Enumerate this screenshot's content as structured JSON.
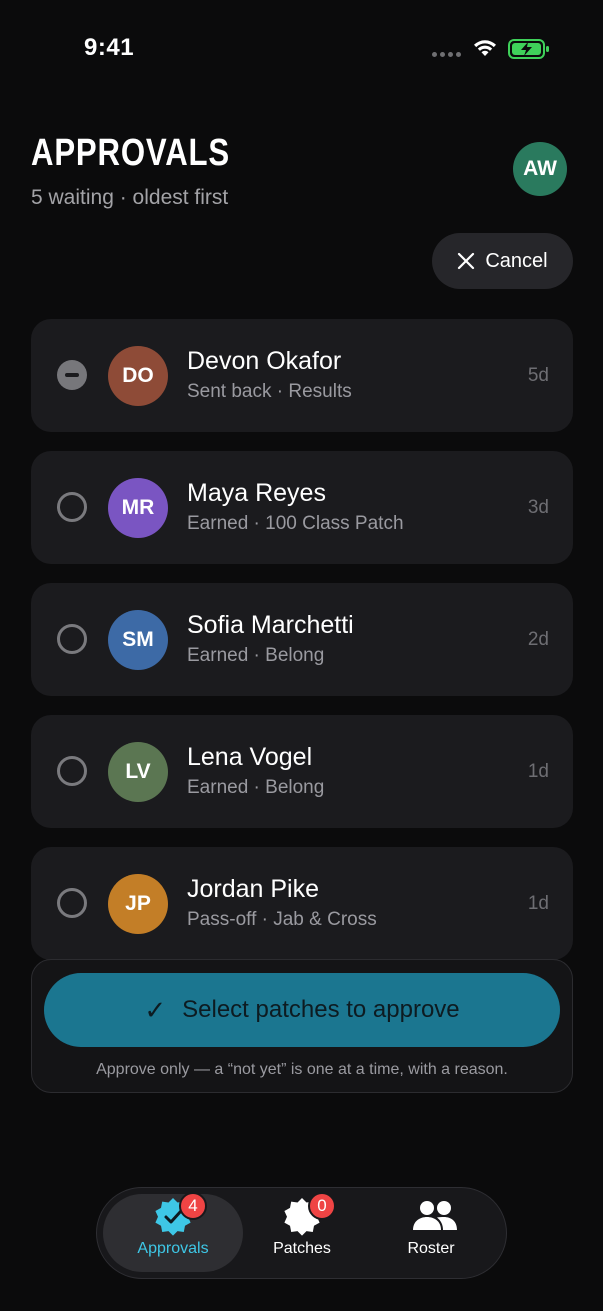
{
  "status_bar": {
    "time": "9:41"
  },
  "header": {
    "title": "APPROVALS",
    "subtitle": "5 waiting · oldest first",
    "user_initials": "AW",
    "cancel_label": "Cancel"
  },
  "colors": {
    "accent": "#1b7690",
    "active_tab": "#3ec7e6",
    "badge": "#ef4444"
  },
  "items": [
    {
      "initials": "DO",
      "name": "Devon Okafor",
      "detail": "Sent back · Results",
      "age": "5d",
      "avatar_color": "#8e4b37",
      "state": "partial"
    },
    {
      "initials": "MR",
      "name": "Maya Reyes",
      "detail": "Earned · 100 Class Patch",
      "age": "3d",
      "avatar_color": "#7a55c2",
      "state": "unselected"
    },
    {
      "initials": "SM",
      "name": "Sofia Marchetti",
      "detail": "Earned · Belong",
      "age": "2d",
      "avatar_color": "#3d6aa6",
      "state": "unselected"
    },
    {
      "initials": "LV",
      "name": "Lena Vogel",
      "detail": "Earned · Belong",
      "age": "1d",
      "avatar_color": "#5b7652",
      "state": "unselected"
    },
    {
      "initials": "JP",
      "name": "Jordan Pike",
      "detail": "Pass-off · Jab & Cross",
      "age": "1d",
      "avatar_color": "#c37e27",
      "state": "unselected"
    }
  ],
  "action": {
    "button_label": "Select patches to approve",
    "note": "Approve only — a “not yet” is one at a time, with a reason."
  },
  "tabs": [
    {
      "label": "Approvals",
      "badge": "4",
      "icon": "verified-badge-icon",
      "active": true
    },
    {
      "label": "Patches",
      "badge": "0",
      "icon": "patch-icon",
      "active": false
    },
    {
      "label": "Roster",
      "icon": "people-icon",
      "active": false
    }
  ]
}
